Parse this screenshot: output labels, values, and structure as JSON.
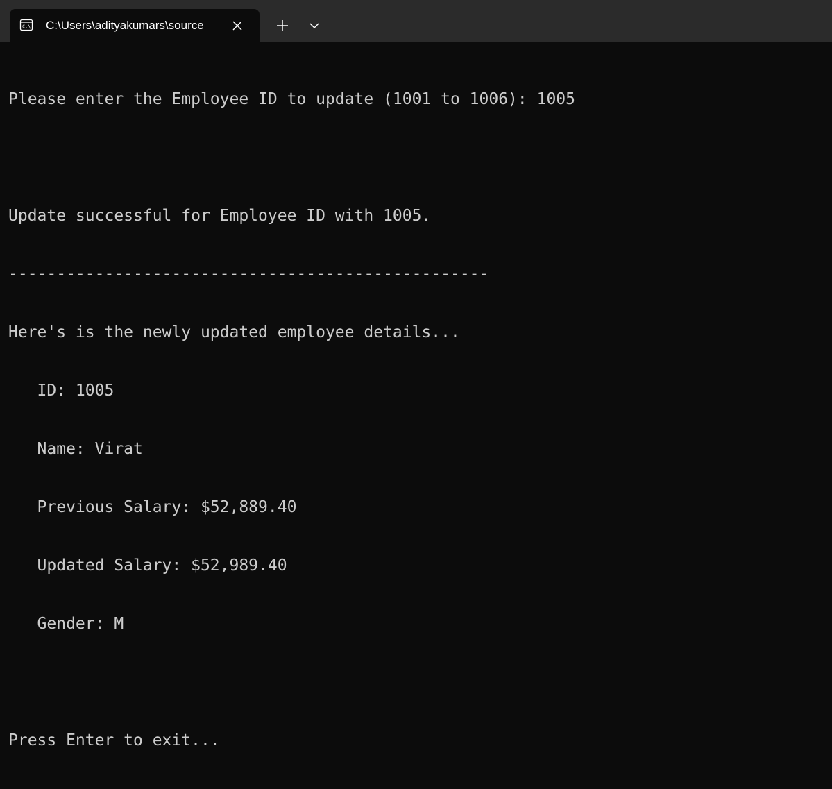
{
  "window": {
    "tab_title": "C:\\Users\\adityakumars\\source",
    "tab_icon": "terminal-icon"
  },
  "console": {
    "lines": [
      "Please enter the Employee ID to update (1001 to 1006): 1005",
      "",
      "Update successful for Employee ID with 1005.",
      "--------------------------------------------------",
      "Here's is the newly updated employee details...",
      "   ID: 1005",
      "   Name: Virat",
      "   Previous Salary: $52,889.40",
      "   Updated Salary: $52,989.40",
      "   Gender: M",
      "",
      "Press Enter to exit..."
    ]
  },
  "colors": {
    "background": "#0c0c0c",
    "titlebar": "#2b2b2b",
    "text": "#cccccc"
  }
}
